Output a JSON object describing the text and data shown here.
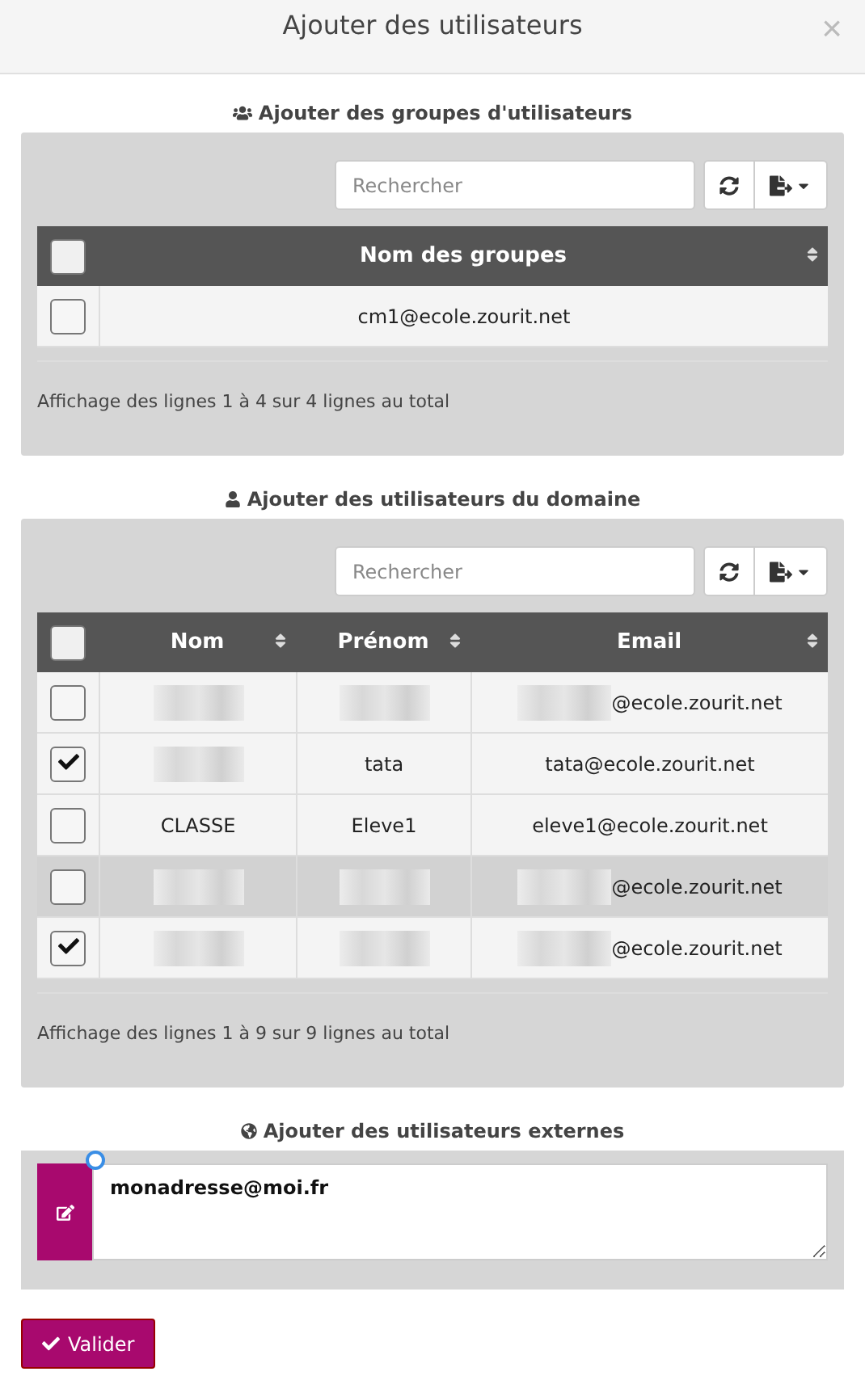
{
  "dialog": {
    "title": "Ajouter des utilisateurs",
    "close": "×"
  },
  "groups_section": {
    "title": "Ajouter des groupes d'utilisateurs",
    "search": {
      "placeholder": "Rechercher"
    },
    "table": {
      "select_all": {
        "checked": false
      },
      "columns": [
        {
          "label": "Nom des groupes",
          "sortable": true
        }
      ],
      "rows": [
        {
          "checked": false,
          "highlighted": false,
          "cells": [
            {
              "text": "cm1@ecole.zourit.net",
              "blurred": false
            }
          ]
        }
      ]
    },
    "footer": "Affichage des lignes 1 à 4 sur 4 lignes au total"
  },
  "domain_section": {
    "title": "Ajouter des utilisateurs du domaine",
    "search": {
      "placeholder": "Rechercher"
    },
    "table": {
      "select_all": {
        "checked": false
      },
      "columns": [
        {
          "label": "Nom",
          "sortable": true
        },
        {
          "label": "Prénom",
          "sortable": true
        },
        {
          "label": "Email",
          "sortable": true
        }
      ],
      "rows": [
        {
          "checked": false,
          "highlighted": false,
          "cells": [
            {
              "blurred": true
            },
            {
              "blurred": true
            },
            {
              "text": "@ecole.zourit.net",
              "blurred": true
            }
          ]
        },
        {
          "checked": true,
          "highlighted": false,
          "cells": [
            {
              "blurred": true
            },
            {
              "text": "tata",
              "blurred": false
            },
            {
              "text": "tata@ecole.zourit.net",
              "blurred": false
            }
          ]
        },
        {
          "checked": false,
          "highlighted": false,
          "cells": [
            {
              "text": "CLASSE",
              "blurred": false
            },
            {
              "text": "Eleve1",
              "blurred": false
            },
            {
              "text": "eleve1@ecole.zourit.net",
              "blurred": false
            }
          ]
        },
        {
          "checked": false,
          "highlighted": true,
          "cells": [
            {
              "blurred": true
            },
            {
              "blurred": true
            },
            {
              "text": "@ecole.zourit.net",
              "blurred": true
            }
          ]
        },
        {
          "checked": true,
          "highlighted": false,
          "cells": [
            {
              "blurred": true
            },
            {
              "blurred": true
            },
            {
              "text": "@ecole.zourit.net",
              "blurred": true
            }
          ]
        }
      ]
    },
    "footer": "Affichage des lignes 1 à 9 sur 9 lignes au total"
  },
  "external_section": {
    "title": "Ajouter des utilisateurs externes",
    "value": "monadresse@moi.fr"
  },
  "submit": {
    "label": "Valider"
  }
}
